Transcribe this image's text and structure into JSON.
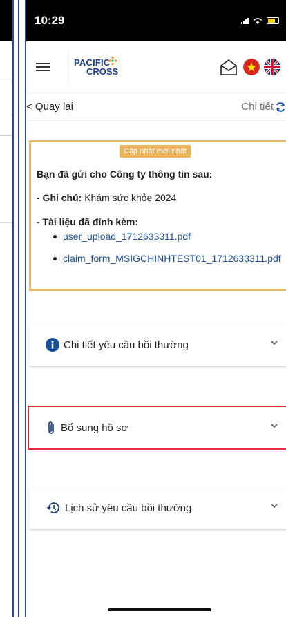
{
  "status_bar": {
    "time": "10:29"
  },
  "app_bar": {
    "logo_line1": "PACIFIC",
    "logo_line2": "CROSS",
    "menu_icon": "hamburger-menu-icon",
    "inbox_icon": "inbox-icon",
    "flags": [
      "vietnam-flag-icon",
      "uk-flag-icon"
    ]
  },
  "nav": {
    "back": "< Quay lại",
    "detail": "Chi tiết"
  },
  "info": {
    "badge": "Cập nhật mới nhất",
    "title": "Bạn đã gửi cho Công ty thông tin sau:",
    "note_label": "- Ghi chú:",
    "note_value": " Khám sức khỏe 2024",
    "attach_label": "- Tài liệu đã đính kèm:",
    "attachments": [
      "user_upload_1712633311.pdf",
      "claim_form_MSIGCHINHTEST01_1712633311.pdf"
    ]
  },
  "sections": [
    {
      "label": "Chi tiết yêu cầu bồi thường",
      "icon": "info-icon"
    },
    {
      "label": "Bổ sung hồ sơ",
      "icon": "paperclip-icon"
    },
    {
      "label": "Lịch sử yêu cầu bồi thường",
      "icon": "history-icon"
    }
  ],
  "colors": {
    "accent_border": "#e8b86a",
    "highlight": "#e03131",
    "brand": "#1f3f8f"
  }
}
